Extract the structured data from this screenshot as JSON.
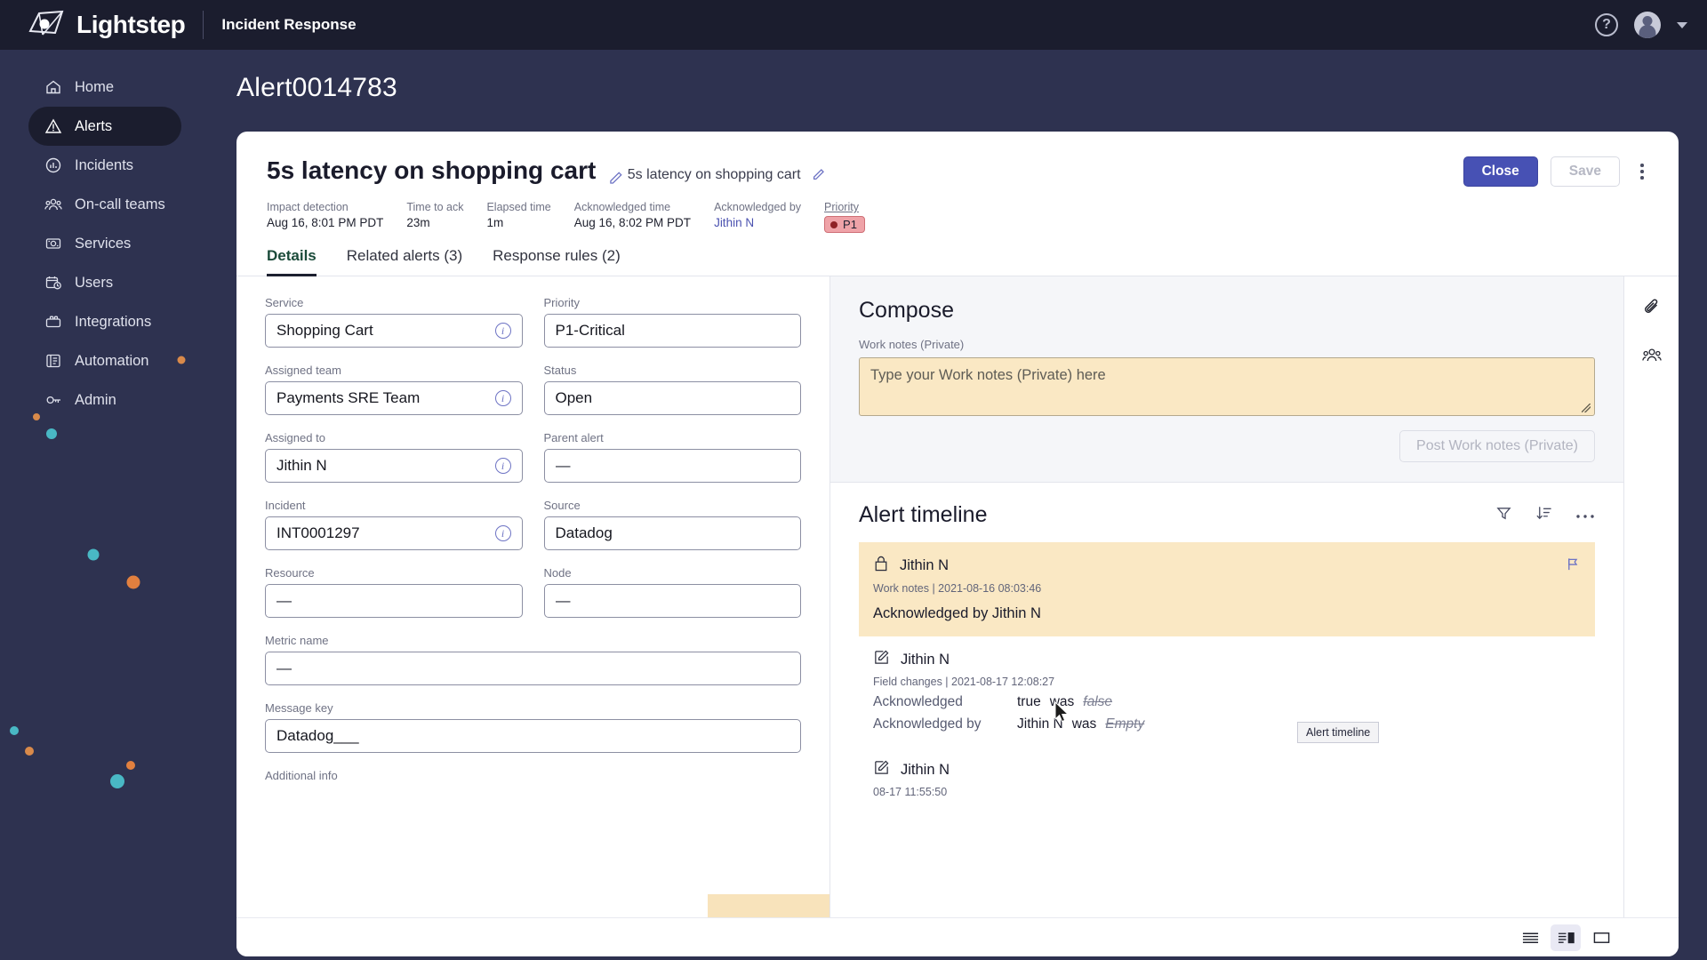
{
  "topbar": {
    "brand": "Lightstep",
    "product": "Incident Response",
    "help_label": "?",
    "logo_icon": "lightstep-cube-logo",
    "help_icon": "help-circle-icon",
    "avatar_icon": "user-avatar",
    "caret_icon": "chevron-down-icon"
  },
  "sidebar": {
    "items": [
      {
        "label": "Home",
        "icon": "home-icon",
        "active": false
      },
      {
        "label": "Alerts",
        "icon": "alert-triangle-icon",
        "active": true
      },
      {
        "label": "Incidents",
        "icon": "incident-chart-icon",
        "active": false
      },
      {
        "label": "On-call teams",
        "icon": "people-group-icon",
        "active": false
      },
      {
        "label": "Services",
        "icon": "services-box-icon",
        "active": false
      },
      {
        "label": "Users",
        "icon": "user-clock-icon",
        "active": false
      },
      {
        "label": "Integrations",
        "icon": "integrations-box-icon",
        "active": false
      },
      {
        "label": "Automation",
        "icon": "automation-book-icon",
        "active": false
      },
      {
        "label": "Admin",
        "icon": "admin-key-icon",
        "active": false
      }
    ]
  },
  "page": {
    "title": "Alert0014783"
  },
  "alert": {
    "title": "5s latency on shopping cart",
    "subtitle": "5s latency on shopping cart",
    "edit_icon": "pencil-edit-icon",
    "actions": {
      "close_label": "Close",
      "save_label": "Save",
      "more_icon": "kebab-menu-icon"
    },
    "meta": [
      {
        "label": "Impact detection",
        "value": "Aug 16, 8:01 PM PDT",
        "style": "plain"
      },
      {
        "label": "Time to ack",
        "value": "23m",
        "style": "plain"
      },
      {
        "label": "Elapsed time",
        "value": "1m",
        "style": "plain"
      },
      {
        "label": "Acknowledged time",
        "value": "Aug 16, 8:02 PM PDT",
        "style": "plain"
      },
      {
        "label": "Acknowledged by",
        "value": "Jithin N",
        "style": "link"
      },
      {
        "label": "Priority",
        "value": "P1",
        "style": "pill"
      }
    ],
    "tabs": [
      {
        "label": "Details",
        "active": true
      },
      {
        "label": "Related alerts (3)",
        "active": false
      },
      {
        "label": "Response rules (2)",
        "active": false
      }
    ]
  },
  "details_form": {
    "rows": [
      [
        {
          "label": "Service",
          "value": "Shopping Cart",
          "info": true
        },
        {
          "label": "Priority",
          "value": "P1-Critical",
          "info": false
        }
      ],
      [
        {
          "label": "Assigned team",
          "value": "Payments SRE Team",
          "info": true
        },
        {
          "label": "Status",
          "value": "Open",
          "info": false
        }
      ],
      [
        {
          "label": "Assigned to",
          "value": "Jithin N",
          "info": true
        },
        {
          "label": "Parent alert",
          "value": "—",
          "info": false
        }
      ],
      [
        {
          "label": "Incident",
          "value": "INT0001297",
          "info": true
        },
        {
          "label": "Source",
          "value": "Datadog",
          "info": false
        }
      ],
      [
        {
          "label": "Resource",
          "value": "—",
          "info": false
        },
        {
          "label": "Node",
          "value": "—",
          "info": false
        }
      ]
    ],
    "wide_rows": [
      {
        "label": "Metric name",
        "value": "—"
      },
      {
        "label": "Message key",
        "value": "Datadog___"
      }
    ],
    "trailing_label": "Additional info",
    "info_icon": "info-circle-icon"
  },
  "compose": {
    "heading": "Compose",
    "field_label": "Work notes (Private)",
    "placeholder": "Type your Work notes (Private) here",
    "value": "",
    "post_label": "Post Work notes (Private)",
    "resize_icon": "resize-handle-icon"
  },
  "timeline": {
    "heading": "Alert timeline",
    "filter_icon": "filter-funnel-icon",
    "sort_icon": "sort-descending-icon",
    "more_icon": "ellipsis-horizontal-icon",
    "entries": [
      {
        "icon": "lock-icon",
        "author": "Jithin N",
        "meta": "Work notes | 2021-08-16 08:03:46",
        "body": "Acknowledged by Jithin N",
        "highlighted": true,
        "flag_icon": "flag-icon",
        "changes": []
      },
      {
        "icon": "edit-note-icon",
        "author": "Jithin N",
        "meta": "Field changes | 2021-08-17 12:08:27",
        "body": "",
        "highlighted": false,
        "flag_icon": "",
        "changes": [
          {
            "key": "Acknowledged",
            "new": "true",
            "was_word": "was",
            "old": "false"
          },
          {
            "key": "Acknowledged by",
            "new": "Jithin N",
            "was_word": "was",
            "old": "Empty"
          }
        ]
      },
      {
        "icon": "edit-note-icon",
        "author": "Jithin N",
        "meta": "08-17 11:55:50",
        "body": "",
        "highlighted": false,
        "flag_icon": "",
        "changes": []
      }
    ]
  },
  "right_rail": {
    "items": [
      {
        "icon": "paperclip-attachment-icon",
        "label": "Attachments"
      },
      {
        "icon": "people-group-icon",
        "label": "Responders"
      }
    ]
  },
  "footer": {
    "buttons": [
      {
        "icon": "list-view-icon",
        "selected": false
      },
      {
        "icon": "split-view-icon",
        "selected": true
      },
      {
        "icon": "full-view-icon",
        "selected": false
      }
    ]
  },
  "tooltip": {
    "text": "Alert timeline"
  },
  "colors": {
    "accent": "#4751b4",
    "sidebar_bg": "#2e3250",
    "topbar_bg": "#1b1d2e",
    "highlight": "#fae8c4",
    "priority_p1": "#efa3a8"
  }
}
